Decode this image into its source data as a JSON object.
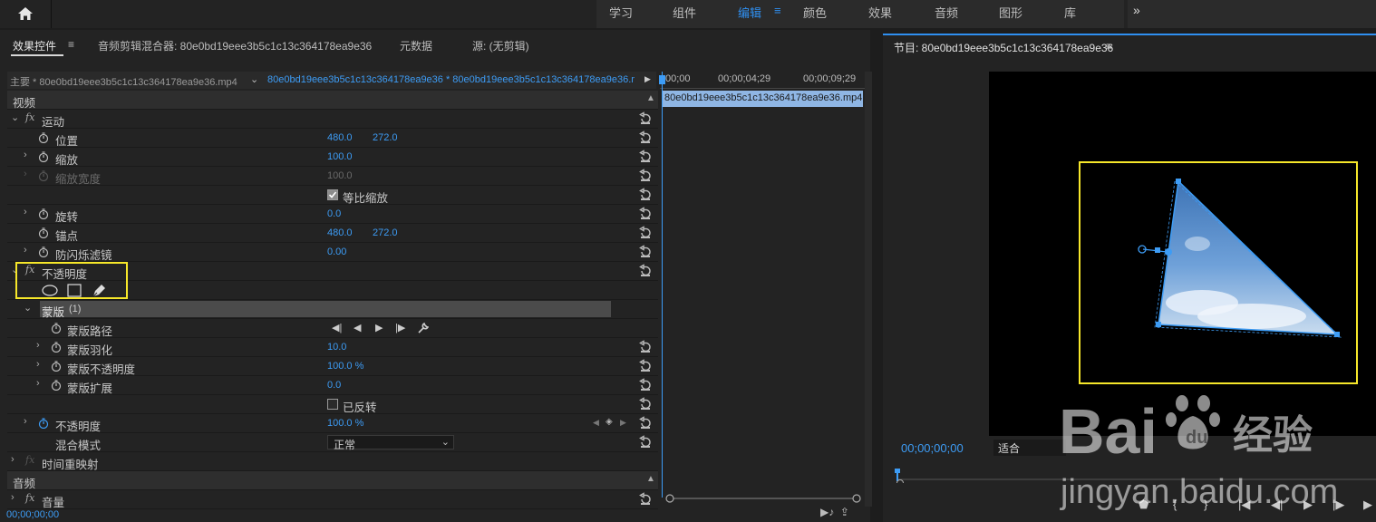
{
  "workspace": {
    "tabs": [
      "学习",
      "组件",
      "编辑",
      "颜色",
      "效果",
      "音频",
      "图形",
      "库"
    ],
    "active": "编辑",
    "more": "»"
  },
  "left_panel": {
    "tabs": {
      "effect_controls": "效果控件",
      "audio_mixer": "音频剪辑混合器: 80e0bd19eee3b5c1c13c364178ea9e36",
      "metadata": "元数据",
      "source": "源: (无剪辑)"
    },
    "src_clip": "主要 * 80e0bd19eee3b5c1c13c364178ea9e36.mp4",
    "seq_clip": "80e0bd19eee3b5c1c13c364178ea9e36 * 80e0bd19eee3b5c1c13c364178ea9e36.mp4",
    "sections": {
      "video": "视频",
      "audio": "音频"
    },
    "motion": {
      "label": "运动",
      "position": {
        "label": "位置",
        "x": "480.0",
        "y": "272.0"
      },
      "scale": {
        "label": "缩放",
        "value": "100.0"
      },
      "scale_width": {
        "label": "缩放宽度",
        "value": "100.0"
      },
      "uniform_scale": "等比缩放",
      "rotation": {
        "label": "旋转",
        "value": "0.0"
      },
      "anchor": {
        "label": "锚点",
        "x": "480.0",
        "y": "272.0"
      },
      "anti_flicker": {
        "label": "防闪烁滤镜",
        "value": "0.00"
      }
    },
    "opacity_fx": {
      "label": "不透明度",
      "mask": {
        "label": "蒙版",
        "count": "(1)",
        "path": "蒙版路径",
        "feather": {
          "label": "蒙版羽化",
          "value": "10.0"
        },
        "opacity": {
          "label": "蒙版不透明度",
          "value": "100.0 %"
        },
        "expansion": {
          "label": "蒙版扩展",
          "value": "0.0"
        },
        "inverted": "已反转"
      },
      "opacity": {
        "label": "不透明度",
        "value": "100.0 %"
      },
      "blend": {
        "label": "混合模式",
        "value": "正常"
      }
    },
    "time_remap": "时间重映射",
    "volume": "音量",
    "status_timecode": "00;00;00;00"
  },
  "mini_timeline": {
    "ticks": [
      "00;00",
      "00;00;04;29",
      "00;00;09;29"
    ],
    "clip": "80e0bd19eee3b5c1c13c364178ea9e36.mp4"
  },
  "program": {
    "title": "节目: 80e0bd19eee3b5c1c13c364178ea9e36",
    "timecode": "00;00;00;00",
    "fit": "适合"
  },
  "watermark": {
    "brand": "Bai",
    "cn": "经验",
    "url": "jingyan.baidu.com"
  },
  "colors": {
    "accent": "#2f8ff0",
    "highlight_box": "#f6e72a",
    "panel_bg": "#232323"
  }
}
